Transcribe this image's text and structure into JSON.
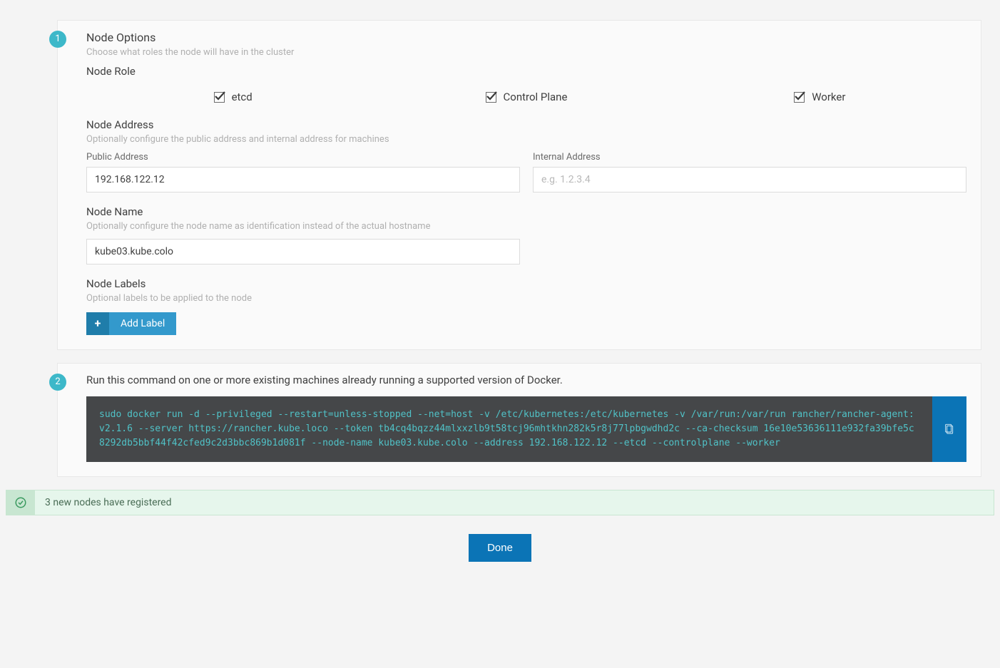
{
  "steps": {
    "one": "1",
    "two": "2"
  },
  "node_options": {
    "title": "Node Options",
    "desc": "Choose what roles the node will have in the cluster",
    "role": {
      "title": "Node Role",
      "etcd": "etcd",
      "control_plane": "Control Plane",
      "worker": "Worker"
    },
    "address": {
      "title": "Node Address",
      "desc": "Optionally configure the public address and internal address for machines",
      "public_label": "Public Address",
      "public_value": "192.168.122.12",
      "internal_label": "Internal Address",
      "internal_placeholder": "e.g. 1.2.3.4"
    },
    "name": {
      "title": "Node Name",
      "desc": "Optionally configure the node name as identification instead of the actual hostname",
      "value": "kube03.kube.colo"
    },
    "labels": {
      "title": "Node Labels",
      "desc": "Optional labels to be applied to the node",
      "add_button": "Add Label"
    }
  },
  "run_command": {
    "desc": "Run this command on one or more existing machines already running a supported version of Docker.",
    "command": "sudo docker run -d --privileged --restart=unless-stopped --net=host -v /etc/kubernetes:/etc/kubernetes -v /var/run:/var/run rancher/rancher-agent:v2.1.6 --server https://rancher.kube.loco --token tb4cq4bqzz44mlxxzlb9t58tcj96mhtkhn282k5r8j77lpbgwdhd2c --ca-checksum 16e10e53636111e932fa39bfe5c8292db5bbf44f42cfed9c2d3bbc869b1d081f --node-name kube03.kube.colo --address 192.168.122.12 --etcd --controlplane --worker"
  },
  "status": {
    "text": "3 new nodes have registered"
  },
  "done": {
    "label": "Done"
  }
}
